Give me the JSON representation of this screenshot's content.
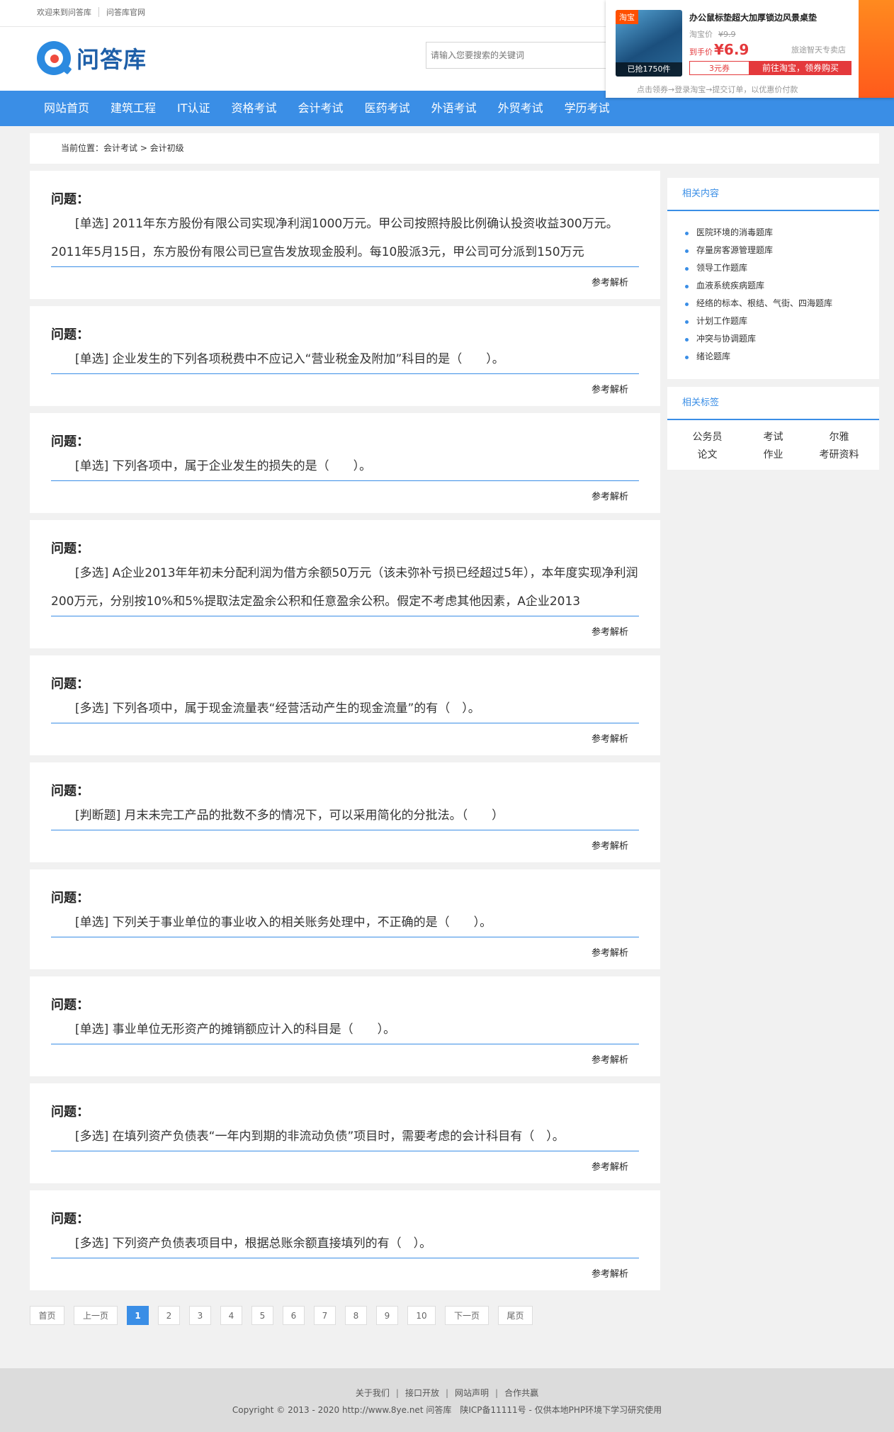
{
  "topbar": {
    "welcome": "欢迎来到问答库",
    "official": "问答库官网"
  },
  "header": {
    "logo_text": "问答库",
    "search_placeholder": "请输入您要搜索的关键词"
  },
  "nav": [
    "网站首页",
    "建筑工程",
    "IT认证",
    "资格考试",
    "会计考试",
    "医药考试",
    "外语考试",
    "外贸考试",
    "学历考试"
  ],
  "ad": {
    "title": "办公鼠标垫超大加厚锁边风景桌垫",
    "store_tag": "淘宝",
    "sold": "已抢1750件",
    "orig_label": "淘宝价",
    "orig_price": "¥9.9",
    "price_label": "到手价",
    "price": "¥6.9",
    "shipping": "旅途智天专卖店",
    "coupon": "3元券",
    "buy": "前往淘宝，领券购买",
    "tip": "点击领券→登录淘宝→提交订单，以优惠价付款"
  },
  "breadcrumb": "当前位置：会计考试 > 会计初级",
  "question_title": "问题：",
  "more_label": "参考解析",
  "questions": [
    "[单选] 2011年东方股份有限公司实现净利润1000万元。甲公司按照持股比例确认投资收益300万元。2011年5月15日，东方股份有限公司已宣告发放现金股利。每10股派3元，甲公司可分派到150万元",
    "[单选] 企业发生的下列各项税费中不应记入“营业税金及附加”科目的是（　　）。",
    "[单选] 下列各项中，属于企业发生的损失的是（　　）。",
    "[多选] A企业2013年年初未分配利润为借方余额50万元（该未弥补亏损已经超过5年），本年度实现净利润200万元，分别按10%和5%提取法定盈余公积和任意盈余公积。假定不考虑其他因素，A企业2013",
    "[多选] 下列各项中，属于现金流量表“经营活动产生的现金流量”的有（　）。",
    "[判断题] 月末未完工产品的批数不多的情况下，可以采用简化的分批法。（　　）",
    "[单选] 下列关于事业单位的事业收入的相关账务处理中，不正确的是（　　）。",
    "[单选] 事业单位无形资产的摊销额应计入的科目是（　　）。",
    "[多选] 在填列资产负债表“一年内到期的非流动负债”项目时，需要考虑的会计科目有（　）。",
    "[多选] 下列资产负债表项目中，根据总账余额直接填列的有（　）。"
  ],
  "sidebar": {
    "related_title": "相关内容",
    "related": [
      "医院环境的消毒题库",
      "存量房客源管理题库",
      "领导工作题库",
      "血液系统疾病题库",
      "经络的标本、根结、气街、四海题库",
      "计划工作题库",
      "冲突与协调题库",
      "绪论题库"
    ],
    "tags_title": "相关标签",
    "tags": [
      "公务员",
      "考试",
      "尔雅",
      "论文",
      "作业",
      "考研资料"
    ]
  },
  "pager": {
    "first": "首页",
    "prev": "上一页",
    "pages": [
      "1",
      "2",
      "3",
      "4",
      "5",
      "6",
      "7",
      "8",
      "9",
      "10"
    ],
    "current": "1",
    "next": "下一页",
    "last": "尾页"
  },
  "footer": {
    "links": [
      "关于我们",
      "接口开放",
      "网站声明",
      "合作共赢"
    ],
    "copyright": "Copyright © 2013 - 2020 http://www.8ye.net 问答库　陕ICP备11111号 - 仅供本地PHP环境下学习研究使用"
  },
  "colors": {
    "primary": "#3a8ee6",
    "accent_red": "#e4393c",
    "background": "#f1f1f1"
  }
}
